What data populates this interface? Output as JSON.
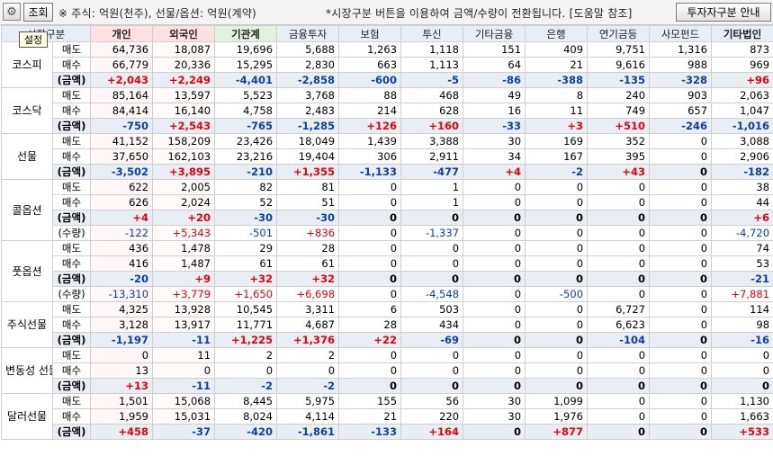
{
  "toolbar": {
    "query_label": "조회",
    "note": "※ 주식: 억원(천주), 선물/옵션: 억원(계약)",
    "hint": "*시장구분 버튼을 이용하여 금액/수량이 전환됩니다. [도움말 참조]",
    "guide_label": "투자자구분 안내",
    "tooltip": "설정"
  },
  "headers": [
    "시장구분",
    "개인",
    "외국인",
    "기관계",
    "금융투자",
    "보험",
    "투신",
    "기타금융",
    "은행",
    "연기금등",
    "사모펀드",
    "기타법인"
  ],
  "markets": [
    {
      "name": "코스피",
      "rows": [
        {
          "label": "매도",
          "kind": "plain",
          "values": [
            "64,736",
            "18,087",
            "19,696",
            "5,688",
            "1,263",
            "1,118",
            "151",
            "409",
            "9,751",
            "1,316",
            "873"
          ]
        },
        {
          "label": "매수",
          "kind": "plain",
          "values": [
            "66,779",
            "20,336",
            "15,295",
            "2,830",
            "663",
            "1,113",
            "64",
            "21",
            "9,616",
            "988",
            "969"
          ]
        },
        {
          "label": "(금액)",
          "kind": "amt",
          "values": [
            "+2,043",
            "+2,249",
            "-4,401",
            "-2,858",
            "-600",
            "-5",
            "-86",
            "-388",
            "-135",
            "-328",
            "+96"
          ]
        }
      ]
    },
    {
      "name": "코스닥",
      "rows": [
        {
          "label": "매도",
          "kind": "plain",
          "values": [
            "85,164",
            "13,597",
            "5,523",
            "3,768",
            "88",
            "468",
            "49",
            "8",
            "240",
            "903",
            "2,063"
          ]
        },
        {
          "label": "매수",
          "kind": "plain",
          "values": [
            "84,414",
            "16,140",
            "4,758",
            "2,483",
            "214",
            "628",
            "16",
            "11",
            "749",
            "657",
            "1,047"
          ]
        },
        {
          "label": "(금액)",
          "kind": "amt",
          "values": [
            "-750",
            "+2,543",
            "-765",
            "-1,285",
            "+126",
            "+160",
            "-33",
            "+3",
            "+510",
            "-246",
            "-1,016"
          ]
        }
      ]
    },
    {
      "name": "선물",
      "rows": [
        {
          "label": "매도",
          "kind": "plain",
          "values": [
            "41,152",
            "158,209",
            "23,426",
            "18,049",
            "1,439",
            "3,388",
            "30",
            "169",
            "352",
            "0",
            "3,088"
          ]
        },
        {
          "label": "매수",
          "kind": "plain",
          "values": [
            "37,650",
            "162,103",
            "23,216",
            "19,404",
            "306",
            "2,911",
            "34",
            "167",
            "395",
            "0",
            "2,906"
          ]
        },
        {
          "label": "(금액)",
          "kind": "amt",
          "values": [
            "-3,502",
            "+3,895",
            "-210",
            "+1,355",
            "-1,133",
            "-477",
            "+4",
            "-2",
            "+43",
            "0",
            "-182"
          ]
        }
      ]
    },
    {
      "name": "콜옵션",
      "rows": [
        {
          "label": "매도",
          "kind": "plain",
          "values": [
            "622",
            "2,005",
            "82",
            "81",
            "0",
            "1",
            "0",
            "0",
            "0",
            "0",
            "38"
          ]
        },
        {
          "label": "매수",
          "kind": "plain",
          "values": [
            "626",
            "2,024",
            "52",
            "51",
            "0",
            "1",
            "0",
            "0",
            "0",
            "0",
            "44"
          ]
        },
        {
          "label": "(금액)",
          "kind": "amt",
          "values": [
            "+4",
            "+20",
            "-30",
            "-30",
            "0",
            "0",
            "0",
            "0",
            "0",
            "0",
            "+6"
          ]
        },
        {
          "label": "(수량)",
          "kind": "qty",
          "values": [
            "-122",
            "+5,343",
            "-501",
            "+836",
            "0",
            "-1,337",
            "0",
            "0",
            "0",
            "0",
            "-4,720"
          ]
        }
      ]
    },
    {
      "name": "풋옵션",
      "rows": [
        {
          "label": "매도",
          "kind": "plain",
          "values": [
            "436",
            "1,478",
            "29",
            "28",
            "0",
            "0",
            "0",
            "0",
            "0",
            "0",
            "74"
          ]
        },
        {
          "label": "매수",
          "kind": "plain",
          "values": [
            "416",
            "1,487",
            "61",
            "61",
            "0",
            "0",
            "0",
            "0",
            "0",
            "0",
            "53"
          ]
        },
        {
          "label": "(금액)",
          "kind": "amt",
          "values": [
            "-20",
            "+9",
            "+32",
            "+32",
            "0",
            "0",
            "0",
            "0",
            "0",
            "0",
            "-21"
          ]
        },
        {
          "label": "(수량)",
          "kind": "qty",
          "values": [
            "-13,310",
            "+3,779",
            "+1,650",
            "+6,698",
            "0",
            "-4,548",
            "0",
            "-500",
            "0",
            "0",
            "+7,881"
          ]
        }
      ]
    },
    {
      "name": "주식선물",
      "rows": [
        {
          "label": "매도",
          "kind": "plain",
          "values": [
            "4,325",
            "13,928",
            "10,545",
            "3,311",
            "6",
            "503",
            "0",
            "0",
            "6,727",
            "0",
            "114"
          ]
        },
        {
          "label": "매수",
          "kind": "plain",
          "values": [
            "3,128",
            "13,917",
            "11,771",
            "4,687",
            "28",
            "434",
            "0",
            "0",
            "6,623",
            "0",
            "98"
          ]
        },
        {
          "label": "(금액)",
          "kind": "amt",
          "values": [
            "-1,197",
            "-11",
            "+1,225",
            "+1,376",
            "+22",
            "-69",
            "0",
            "0",
            "-104",
            "0",
            "-16"
          ]
        }
      ]
    },
    {
      "name": "변동성 선물",
      "rows": [
        {
          "label": "매도",
          "kind": "plain",
          "values": [
            "0",
            "11",
            "2",
            "2",
            "0",
            "0",
            "0",
            "0",
            "0",
            "0",
            "0"
          ]
        },
        {
          "label": "매수",
          "kind": "plain",
          "values": [
            "13",
            "0",
            "0",
            "0",
            "0",
            "0",
            "0",
            "0",
            "0",
            "0",
            "0"
          ]
        },
        {
          "label": "(금액)",
          "kind": "amt",
          "values": [
            "+13",
            "-11",
            "-2",
            "-2",
            "0",
            "0",
            "0",
            "0",
            "0",
            "0",
            "0"
          ]
        }
      ]
    },
    {
      "name": "달러선물",
      "rows": [
        {
          "label": "매도",
          "kind": "plain",
          "values": [
            "1,501",
            "15,068",
            "8,445",
            "5,975",
            "155",
            "56",
            "30",
            "1,099",
            "0",
            "0",
            "1,130"
          ]
        },
        {
          "label": "매수",
          "kind": "plain",
          "values": [
            "1,959",
            "15,031",
            "8,024",
            "4,114",
            "21",
            "220",
            "30",
            "1,976",
            "0",
            "0",
            "1,663"
          ]
        },
        {
          "label": "(금액)",
          "kind": "amt",
          "values": [
            "+458",
            "-37",
            "-420",
            "-1,861",
            "-133",
            "+164",
            "0",
            "+877",
            "0",
            "0",
            "+533"
          ]
        }
      ]
    }
  ],
  "colors": {
    "positive": "#e8000b",
    "negative": "#0a3fa8",
    "header_bg": "#e8eef5",
    "amount_row_bg": "#e9eef4"
  }
}
